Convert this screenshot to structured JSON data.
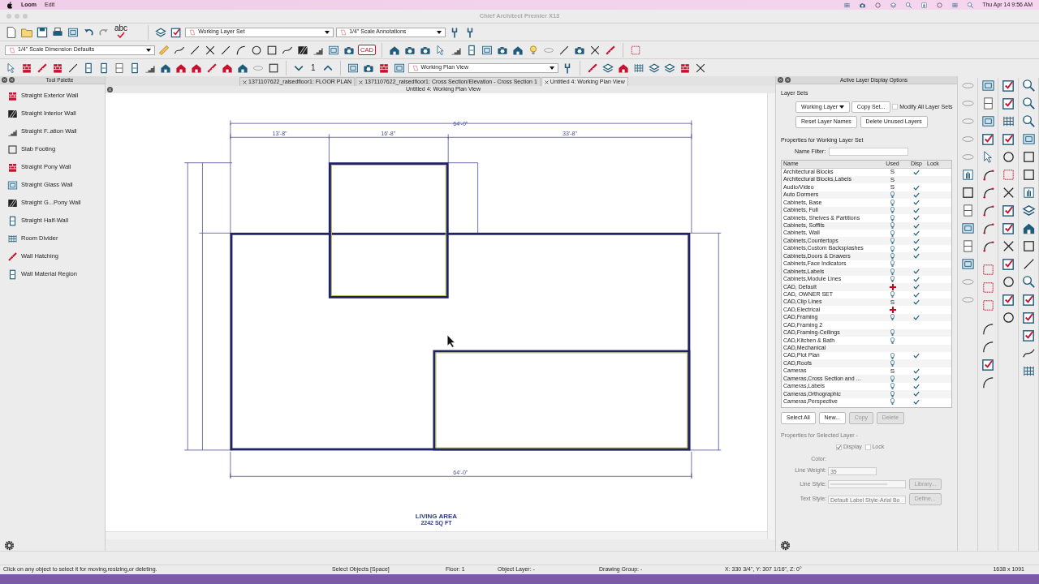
{
  "menubar": {
    "app": "Loom",
    "items": [
      "Edit"
    ],
    "clock": "Thu Apr 14  9:56 AM"
  },
  "window": {
    "title": "Chief Architect Premier X13"
  },
  "toolbar": {
    "spellcheck_label": "abc",
    "layer_set": "Working Layer Set",
    "annotation_set": "1/4\" Scale Annotations",
    "dimension_defaults": "1/4\" Scale Dimension Defaults",
    "cad_label": "CAD",
    "floor_number": "1",
    "plan_view": "Working Plan View"
  },
  "tabs": [
    {
      "label": "1371107622_raisedfloor1:  FLOOR PLAN",
      "selected": false
    },
    {
      "label": "1371107622_raisedfloor1: Cross Section/Elevation - Cross Section 1",
      "selected": false
    },
    {
      "label": "Untitled 4:  Working Plan View",
      "selected": true
    }
  ],
  "tool_palette": {
    "title": "Tool Palette",
    "items": [
      "Straight Exterior Wall",
      "Straight Interior Wall",
      "Straight F..ation Wall",
      "Slab Footing",
      "Straight Pony Wall",
      "Straight Glass Wall",
      "Straight G...Pony Wall",
      "Straight Half-Wall",
      "Room Divider",
      "Wall Hatching",
      "Wall Material Region"
    ]
  },
  "canvas": {
    "title": "Untitled 4:  Working Plan View",
    "dimensions": {
      "overall_top": "64'-0\"",
      "segments": [
        "13'-8\"",
        "16'-8\"",
        "33'-8\""
      ],
      "overall_bottom": "64'-0\""
    },
    "room_label": "LIVING AREA",
    "room_area": "2242 SQ FT"
  },
  "layer_panel": {
    "title": "Active Layer Display Options",
    "layer_sets_label": "Layer Sets",
    "layer_set_choice": "Working Layer",
    "copy_set": "Copy Set...",
    "modify_all": {
      "label": "Modify All Layer Sets",
      "checked": false
    },
    "reset_names": "Reset Layer Names",
    "delete_unused": "Delete Unused Layers",
    "properties_for": "Properties for  Working Layer Set",
    "name_filter_label": "Name Filter:",
    "columns": [
      "Name",
      "Used",
      "Disp",
      "Lock"
    ],
    "layers": [
      {
        "name": "Architectural Blocks",
        "kind": "letter",
        "used": "S",
        "displayed": true
      },
      {
        "name": "Architectural Blocks,Labels",
        "kind": "letter",
        "used": "S",
        "displayed": false
      },
      {
        "name": "Audio/Video",
        "kind": "letter",
        "used": "S",
        "displayed": true
      },
      {
        "name": "Auto Dormers",
        "kind": "bulb",
        "displayed": true
      },
      {
        "name": "Cabinets, Base",
        "kind": "bulb",
        "displayed": true
      },
      {
        "name": "Cabinets, Full",
        "kind": "bulb",
        "displayed": true
      },
      {
        "name": "Cabinets, Shelves & Partitions",
        "kind": "bulb",
        "displayed": true
      },
      {
        "name": "Cabinets, Soffits",
        "kind": "bulb",
        "displayed": true
      },
      {
        "name": "Cabinets, Wall",
        "kind": "bulb",
        "displayed": true
      },
      {
        "name": "Cabinets,Countertops",
        "kind": "bulb",
        "displayed": true
      },
      {
        "name": "Cabinets,Custom Backsplashes",
        "kind": "bulb",
        "displayed": true
      },
      {
        "name": "Cabinets,Doors & Drawers",
        "kind": "bulb",
        "displayed": true
      },
      {
        "name": "Cabinets,Face Indicators",
        "kind": "bulb",
        "displayed": false
      },
      {
        "name": "Cabinets,Labels",
        "kind": "bulb",
        "displayed": true
      },
      {
        "name": "Cabinets,Module Lines",
        "kind": "bulb",
        "displayed": true
      },
      {
        "name": "CAD, Default",
        "kind": "plus",
        "displayed": true
      },
      {
        "name": "CAD, OWNER SET",
        "kind": "bulb",
        "displayed": true
      },
      {
        "name": "CAD,Clip Lines",
        "kind": "letter",
        "used": "S",
        "displayed": true
      },
      {
        "name": "CAD,Electrical",
        "kind": "plus",
        "displayed": false
      },
      {
        "name": "CAD,Framing",
        "kind": "bulb",
        "displayed": true
      },
      {
        "name": "CAD,Framing 2",
        "kind": "empty",
        "displayed": false
      },
      {
        "name": "CAD,Framing-Ceilings",
        "kind": "bulb",
        "displayed": false
      },
      {
        "name": "CAD,Kitchen & Bath",
        "kind": "bulb",
        "displayed": false
      },
      {
        "name": "CAD,Mechanical",
        "kind": "empty",
        "displayed": false
      },
      {
        "name": "CAD,Plot Plan",
        "kind": "bulb",
        "displayed": true
      },
      {
        "name": "CAD,Roofs",
        "kind": "bulb",
        "displayed": false
      },
      {
        "name": "Cameras",
        "kind": "letter",
        "used": "S",
        "displayed": true
      },
      {
        "name": "Cameras,Cross Section and ...",
        "kind": "bulb",
        "displayed": true
      },
      {
        "name": "Cameras,Labels",
        "kind": "bulb",
        "displayed": true
      },
      {
        "name": "Cameras,Orthographic",
        "kind": "bulb",
        "displayed": true
      },
      {
        "name": "Cameras,Perspective",
        "kind": "bulb",
        "displayed": true
      }
    ],
    "buttons": [
      {
        "label": "Select All",
        "disabled": false
      },
      {
        "label": "New...",
        "disabled": false
      },
      {
        "label": "Copy",
        "disabled": true
      },
      {
        "label": "Delete",
        "disabled": true
      }
    ],
    "selected_layer": {
      "heading": "Properties for Selected Layer -",
      "display": {
        "label": "Display",
        "checked": true
      },
      "lock": {
        "label": "Lock",
        "checked": false
      },
      "color_label": "Color:",
      "line_weight_label": "Line Weight:",
      "line_weight": "35",
      "line_style_label": "Line Style:",
      "text_style_label": "Text Style:",
      "text_style": "Default Label Style-Arial Bo",
      "library": "Library...",
      "define": "Define..."
    }
  },
  "status_bar": [
    "Click on any object to select it for moving,resizing,or deleting.",
    "Select Objects [Space]",
    "Floor: 1",
    "Object Layer: -",
    "Drawing Group: -",
    "X: 330 3/4\", Y: 307 1/16\", Z: 0°",
    "1638 x 1091"
  ]
}
